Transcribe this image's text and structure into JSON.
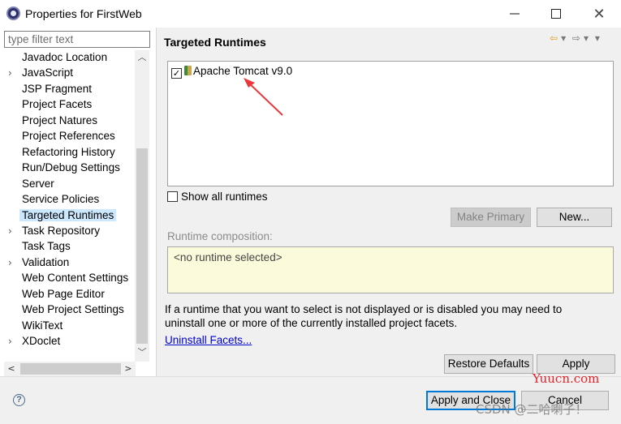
{
  "window": {
    "title": "Properties for FirstWeb",
    "minimize_icon": "minimize-icon",
    "maximize_icon": "maximize-icon",
    "close_icon": "close-icon"
  },
  "sidebar": {
    "filter_placeholder": "type filter text",
    "items": [
      {
        "label": "Javadoc Location",
        "expandable": false,
        "selected": false
      },
      {
        "label": "JavaScript",
        "expandable": true,
        "selected": false
      },
      {
        "label": "JSP Fragment",
        "expandable": false,
        "selected": false
      },
      {
        "label": "Project Facets",
        "expandable": false,
        "selected": false
      },
      {
        "label": "Project Natures",
        "expandable": false,
        "selected": false
      },
      {
        "label": "Project References",
        "expandable": false,
        "selected": false
      },
      {
        "label": "Refactoring History",
        "expandable": false,
        "selected": false
      },
      {
        "label": "Run/Debug Settings",
        "expandable": false,
        "selected": false
      },
      {
        "label": "Server",
        "expandable": false,
        "selected": false
      },
      {
        "label": "Service Policies",
        "expandable": false,
        "selected": false
      },
      {
        "label": "Targeted Runtimes",
        "expandable": false,
        "selected": true
      },
      {
        "label": "Task Repository",
        "expandable": true,
        "selected": false
      },
      {
        "label": "Task Tags",
        "expandable": false,
        "selected": false
      },
      {
        "label": "Validation",
        "expandable": true,
        "selected": false
      },
      {
        "label": "Web Content Settings",
        "expandable": false,
        "selected": false
      },
      {
        "label": "Web Page Editor",
        "expandable": false,
        "selected": false
      },
      {
        "label": "Web Project Settings",
        "expandable": false,
        "selected": false
      },
      {
        "label": "WikiText",
        "expandable": false,
        "selected": false
      },
      {
        "label": "XDoclet",
        "expandable": true,
        "selected": false
      }
    ]
  },
  "page": {
    "title": "Targeted Runtimes",
    "runtimes": [
      {
        "label": "Apache Tomcat v9.0",
        "checked": true
      }
    ],
    "show_all_label": "Show all runtimes",
    "show_all_checked": false,
    "make_primary_label": "Make Primary",
    "new_label": "New...",
    "composition_label": "Runtime composition:",
    "composition_value": "<no runtime selected>",
    "info_text": "If a runtime that you want to select is not displayed or is disabled you may need to uninstall one or more of the currently installed project facets.",
    "uninstall_link": "Uninstall Facets...",
    "restore_defaults_label": "Restore Defaults",
    "apply_label": "Apply"
  },
  "footer": {
    "apply_close_label": "Apply and Close",
    "cancel_label": "Cancel"
  },
  "watermark": {
    "site": "Yuucn.com",
    "csdn": "CSDN @二哈喇子！"
  },
  "colors": {
    "selection": "#cce8ff",
    "accent": "#0078d7",
    "link": "#0000cc",
    "arrow": "#e8383d"
  }
}
